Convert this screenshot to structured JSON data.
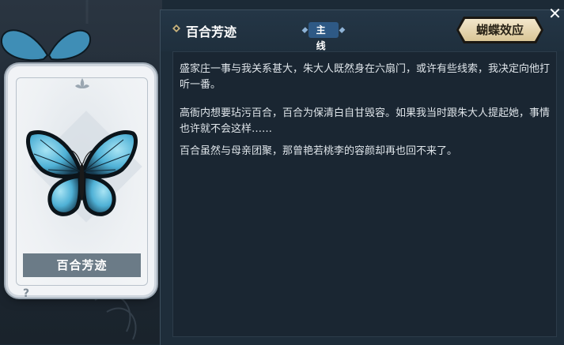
{
  "panel": {
    "title": "百合芳迹",
    "tag": "主线",
    "effect_button": "蝴蝶效应",
    "close_symbol": "✕",
    "paragraphs": [
      "盛家庄一事与我关系甚大，朱大人既然身在六扇门，或许有些线索，我决定向他打听一番。",
      "高衙内想要玷污百合，百合为保清白自甘毁容。如果我当时跟朱大人提起她，事情也许就不会这样……",
      "百合虽然与母亲团聚，那曾艳若桃李的容颜却再也回不来了。"
    ]
  },
  "card": {
    "name": "百合芳迹",
    "icon": "butterfly-icon"
  },
  "side": {
    "help_symbol": "?"
  },
  "colors": {
    "panel_bg": "#1e2d3a",
    "tag_bg": "#2e5985",
    "effect_button_bg": "#e8d9b3",
    "butterfly_blue": "#5ab8d8"
  }
}
